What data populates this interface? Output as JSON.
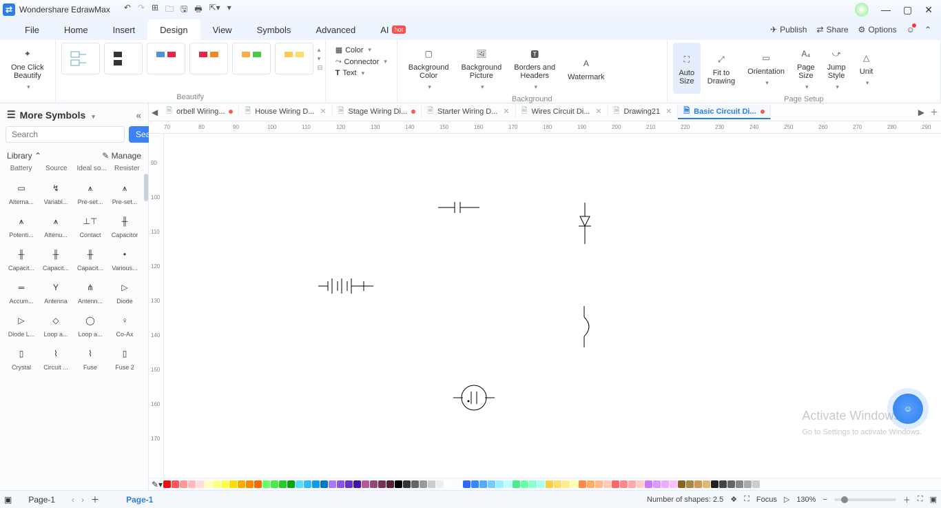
{
  "app": {
    "title": "Wondershare EdrawMax"
  },
  "menubar": {
    "items": [
      "File",
      "Home",
      "Insert",
      "Design",
      "View",
      "Symbols",
      "Advanced",
      "AI"
    ],
    "active": "Design",
    "right": {
      "publish": "Publish",
      "share": "Share",
      "options": "Options"
    }
  },
  "ribbon": {
    "oneclick": "One Click\nBeautify",
    "color": "Color",
    "connector": "Connector",
    "text": "Text",
    "bgcolor": "Background\nColor",
    "bgpic": "Background\nPicture",
    "borders": "Borders and\nHeaders",
    "watermark": "Watermark",
    "autosize": "Auto\nSize",
    "fit": "Fit to\nDrawing",
    "orient": "Orientation",
    "psize": "Page\nSize",
    "jstyle": "Jump\nStyle",
    "unit": "Unit",
    "g_beautify": "Beautify",
    "g_bg": "Background",
    "g_pagesetup": "Page Setup"
  },
  "left": {
    "heading": "More Symbols",
    "search_ph": "Search",
    "search_btn": "Search",
    "library": "Library",
    "manage": "Manage",
    "cats": [
      "Battery",
      "Source",
      "Ideal so...",
      "Resister"
    ],
    "symbols": [
      [
        "Alterna...",
        "Variabl...",
        "Pre-set...",
        "Pre-set..."
      ],
      [
        "Potenti...",
        "Attenu...",
        "Contact",
        "Capacitor"
      ],
      [
        "Capacit...",
        "Capacit...",
        "Capacit...",
        "Various..."
      ],
      [
        "Accum...",
        "Antenna",
        "Antenn...",
        "Diode"
      ],
      [
        "Diode L...",
        "Loop a...",
        "Loop a...",
        "Co-Ax"
      ],
      [
        "Crystal",
        "Circuit ...",
        "Fuse",
        "Fuse 2"
      ]
    ]
  },
  "tabs": [
    {
      "label": "orbell Wiring...",
      "mod": true
    },
    {
      "label": "House Wiring D...",
      "mod": false,
      "close": true
    },
    {
      "label": "Stage Wiring Di...",
      "mod": true
    },
    {
      "label": "Starter Wiring D...",
      "mod": false,
      "close": true
    },
    {
      "label": "Wires Circuit Di...",
      "mod": false,
      "close": true
    },
    {
      "label": "Drawing21",
      "mod": false,
      "close": true
    },
    {
      "label": "Basic Circuit Di...",
      "mod": true,
      "active": true
    }
  ],
  "ruler_h": [
    70,
    80,
    90,
    100,
    110,
    120,
    130,
    140,
    150,
    160,
    170,
    180,
    190,
    200,
    210,
    220,
    230,
    240,
    250,
    260,
    270,
    280,
    290
  ],
  "ruler_v": [
    90,
    100,
    110,
    120,
    130,
    140,
    150,
    160,
    170
  ],
  "page": {
    "tab1": "Page-1",
    "tab2": "Page-1"
  },
  "status": {
    "shapes": "Number of shapes: 2.5",
    "focus": "Focus",
    "zoom": "130%"
  },
  "watermark": {
    "l1": "Activate Windows",
    "l2": "Go to Settings to activate Windows."
  },
  "colors": [
    "#e11",
    "#f55",
    "#f99",
    "#fbb",
    "#fdd",
    "#ffb",
    "#ff8",
    "#ff4",
    "#fd0",
    "#fa0",
    "#f80",
    "#f60",
    "#6f6",
    "#4e4",
    "#2c2",
    "#0a0",
    "#5df",
    "#3bf",
    "#19e",
    "#07c",
    "#a7f",
    "#85e",
    "#63c",
    "#41a",
    "#b59",
    "#947",
    "#735",
    "#523",
    "#000",
    "#333",
    "#666",
    "#999",
    "#ccc",
    "#eee",
    "#fff"
  ],
  "colors2": [
    "#36f",
    "#38f",
    "#5af",
    "#7cf",
    "#9ef",
    "#bff",
    "#4e8",
    "#6fa",
    "#8fc",
    "#afe",
    "#fc4",
    "#fd6",
    "#fe8",
    "#ffa",
    "#f84",
    "#fa6",
    "#fb8",
    "#fcb",
    "#f66",
    "#f88",
    "#faa",
    "#fcc",
    "#c7f",
    "#d9f",
    "#eaf",
    "#fbf",
    "#862",
    "#a84",
    "#c95",
    "#db7",
    "#222",
    "#444",
    "#666",
    "#888",
    "#aaa",
    "#ccc"
  ]
}
